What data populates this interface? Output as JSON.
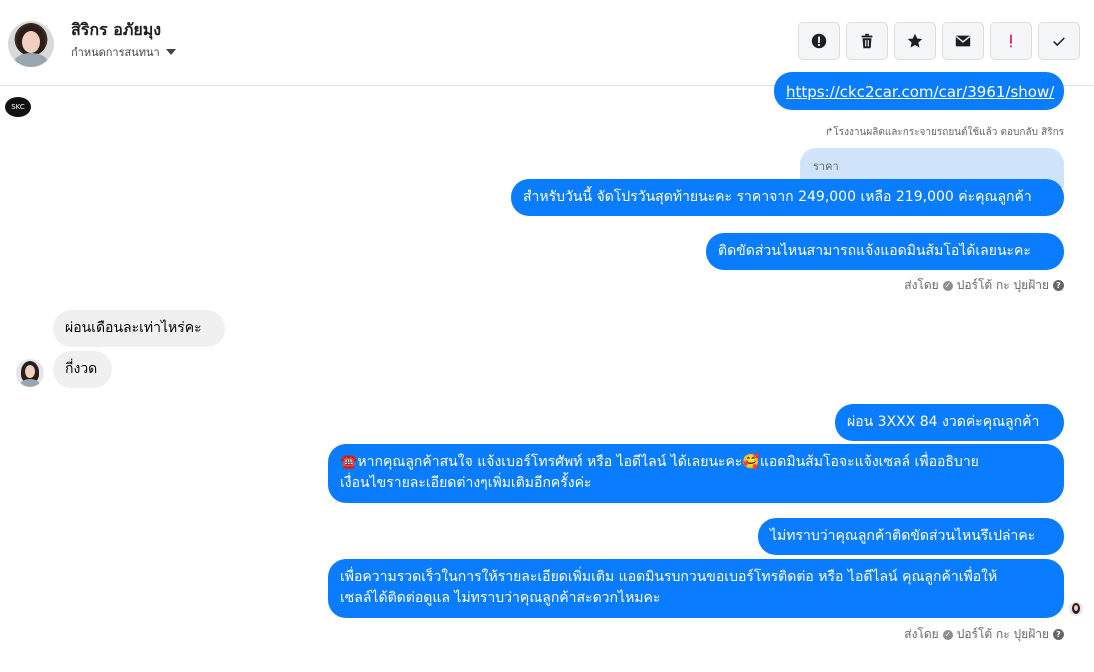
{
  "header": {
    "name": "สิริกร อภัยมุง",
    "subtitle": "กำหนดการสนทนา"
  },
  "toolbar": {
    "buttons": [
      {
        "icon": "alert-circle-icon"
      },
      {
        "icon": "trash-icon"
      },
      {
        "icon": "star-icon"
      },
      {
        "icon": "envelope-icon"
      },
      {
        "icon": "exclamation-icon",
        "color": "#e0245e"
      },
      {
        "icon": "check-icon"
      }
    ]
  },
  "page_badge": "SKC",
  "messages": {
    "link": "https://ckc2car.com/car/3961/show/",
    "reply_meta": "โรงงานผลิตและกระจายรถยนต์ใช้แล้ว ตอบกลับ สิริกร",
    "quoted": "ราคา",
    "m1": "สำหรับวันนี้ จัดโปรวันสุดท้ายนะคะ ราคาจาก 249,000  เหลือ 219,000 ค่ะคุณลูกค้า",
    "m2": "ติดขัดส่วนไหนสามารถแจ้งแอดมินส้มโอได้เลยนะคะ",
    "sent_by_1": "ส่งโดย",
    "sent_by_name_1": "ปอร์โต้ กะ ปุยฝ้าย",
    "in1": "ผ่อนเดือนละเท่าไหร่คะ",
    "in2": "กี่งวด",
    "m3": "ผ่อน 3XXX  84 งวดค่ะคุณลูกค้า",
    "m4_line1": "☎️หากคุณลูกค้าสนใจ แจ้งเบอร์โทรศัพท์ หรือ ไอดีไลน์  ได้เลยนะคะ🥰แอดมินส้มโอจะแจ้งเซลล์   เพื่ออธิบาย",
    "m4_line2": "เงื่อนไขรายละเอียดต่างๆเพิ่มเติมอีกครั้งค่ะ",
    "m5": "ไม่ทราบว่าคุณลูกค้าติดขัดส่วนไหนรึเปล่าคะ",
    "m6_line1": "เพื่อความรวดเร็วในการให้รายละเอียดเพิ่มเติม แอดมินรบกวนขอเบอร์โทรติดต่อ หรือ ไอดีไลน์ คุณลูกค้าเพื่อให้",
    "m6_line2": "เซลล์ได้ติดต่อดูแล ไม่ทราบว่าคุณลูกค้าสะดวกไหมคะ",
    "sent_by_2": "ส่งโดย",
    "sent_by_name_2": "ปอร์โต้ กะ ปุยฝ้าย"
  }
}
